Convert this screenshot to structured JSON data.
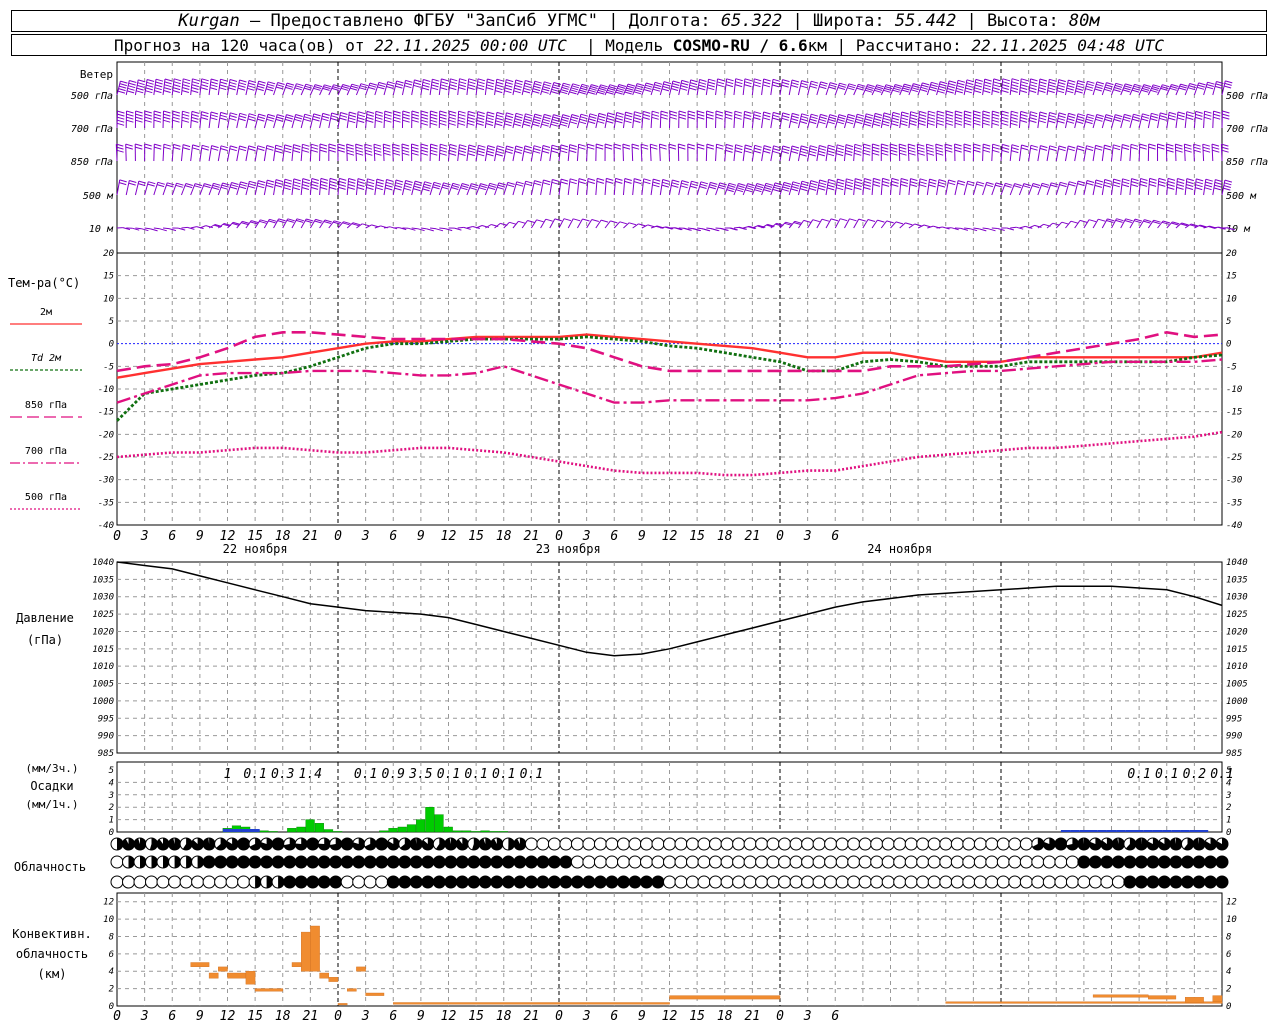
{
  "header": {
    "station": "Kurgan",
    "dash": " – ",
    "provider": "Предоставлено ФГБУ \"ЗапСиб УГМС\"",
    "sep": " | ",
    "lon_label": "Долгота: ",
    "lon": "65.322",
    "lat_label": "Широта: ",
    "lat": "55.442",
    "alt_label": "Высота: ",
    "alt": "80м",
    "forecast_label": "Прогноз на 120 часа(ов) от ",
    "forecast_time": "22.11.2025 00:00 UTC",
    "model_label": "  | Модель ",
    "model": "COSMO-RU / 6.6",
    "model_unit": "км",
    "calc_label": " | Рассчитано: ",
    "calc_time": "22.11.2025 04:48 UTC"
  },
  "colors": {
    "wind": "#8000c8",
    "t2m": "#ff3030",
    "td2m": "#107010",
    "t850": "#e01080",
    "t700": "#e01080",
    "t500": "#e01080",
    "zero": "#2020ff",
    "pressure": "#000000",
    "precip_total": "#00cc00",
    "precip_hourly": "#2040d0",
    "conv": "#f08c30",
    "grid": "#999999"
  },
  "chart_data": [
    {
      "type": "wind",
      "label": "Ветер",
      "levels": [
        "500 гПа",
        "700 гПа",
        "850 гПа",
        "500 м",
        "10  м"
      ],
      "x_hours": [
        0,
        120
      ],
      "icon": "wind-barb-icon"
    },
    {
      "type": "line",
      "ylabel": "Тем-ра(°С)",
      "ylim": [
        -40,
        20
      ],
      "yticks": [
        20,
        15,
        10,
        5,
        0,
        -5,
        -10,
        -15,
        -20,
        -25,
        -30,
        -35,
        -40
      ],
      "x_tick_labels": [
        "0",
        "3",
        "6",
        "9",
        "12",
        "15",
        "18",
        "21",
        "0",
        "3",
        "6",
        "9",
        "12",
        "15",
        "18",
        "21",
        "0",
        "3",
        "6",
        "9",
        "12",
        "15",
        "18",
        "21",
        "0",
        "3",
        "6"
      ],
      "day_labels": [
        "22 ноября",
        "23 ноября",
        "24 ноября"
      ],
      "series": [
        {
          "name": "2м",
          "x": [
            0,
            3,
            6,
            9,
            12,
            15,
            18,
            21,
            24,
            27,
            30,
            33,
            36,
            39,
            42,
            45,
            48,
            51,
            54,
            57,
            60,
            63,
            66,
            69,
            72,
            75,
            78,
            81,
            84,
            87,
            90,
            93,
            96,
            99,
            102,
            105,
            108,
            111,
            114,
            117,
            120
          ],
          "values": [
            -7.5,
            -6.5,
            -5.5,
            -4.5,
            -4,
            -3.5,
            -3,
            -2,
            -1,
            0,
            0.5,
            0.5,
            1,
            1.5,
            1.5,
            1.5,
            1.5,
            2,
            1.5,
            1,
            0.5,
            0,
            -0.5,
            -1,
            -2,
            -3,
            -3,
            -2,
            -2,
            -3,
            -4,
            -4,
            -4,
            -3,
            -3,
            -3,
            -3,
            -3,
            -3,
            -3,
            -2
          ]
        },
        {
          "name": "Td 2м",
          "x": [
            0,
            3,
            6,
            9,
            12,
            15,
            18,
            21,
            24,
            27,
            30,
            33,
            36,
            39,
            42,
            45,
            48,
            51,
            54,
            57,
            60,
            63,
            66,
            69,
            72,
            75,
            78,
            81,
            84,
            87,
            90,
            93,
            96,
            99,
            102,
            105,
            108,
            111,
            114,
            117,
            120
          ],
          "values": [
            -17,
            -11,
            -10,
            -9,
            -8,
            -7,
            -6.5,
            -5,
            -3,
            -1,
            0,
            0,
            0.5,
            1,
            1,
            1,
            1,
            1.5,
            1,
            0.5,
            -0.5,
            -1,
            -2,
            -3,
            -4,
            -6,
            -6,
            -4,
            -3.5,
            -4,
            -5,
            -5,
            -5,
            -4,
            -4,
            -4,
            -4,
            -4,
            -4,
            -3,
            -2.5
          ]
        },
        {
          "name": "850 гПа",
          "x": [
            0,
            3,
            6,
            9,
            12,
            15,
            18,
            21,
            24,
            27,
            30,
            33,
            36,
            39,
            42,
            45,
            48,
            51,
            54,
            57,
            60,
            63,
            66,
            69,
            72,
            75,
            78,
            81,
            84,
            87,
            90,
            93,
            96,
            99,
            102,
            105,
            108,
            111,
            114,
            117,
            120
          ],
          "values": [
            -6,
            -5,
            -4.5,
            -3,
            -1,
            1.5,
            2.5,
            2.5,
            2,
            1.5,
            1,
            1,
            1,
            1,
            1,
            0.5,
            0,
            -1,
            -3,
            -5,
            -6,
            -6,
            -6,
            -6,
            -6,
            -6,
            -6,
            -6,
            -5,
            -5,
            -5,
            -4.5,
            -4,
            -3,
            -2,
            -1,
            0,
            1,
            2.5,
            1.5,
            2
          ]
        },
        {
          "name": "700 гПа",
          "x": [
            0,
            3,
            6,
            9,
            12,
            15,
            18,
            21,
            24,
            27,
            30,
            33,
            36,
            39,
            42,
            45,
            48,
            51,
            54,
            57,
            60,
            63,
            66,
            69,
            72,
            75,
            78,
            81,
            84,
            87,
            90,
            93,
            96,
            99,
            102,
            105,
            108,
            111,
            114,
            117,
            120
          ],
          "values": [
            -13,
            -11,
            -9,
            -7,
            -6.5,
            -6.5,
            -6.5,
            -6,
            -6,
            -6,
            -6.5,
            -7,
            -7,
            -6.5,
            -5,
            -7,
            -9,
            -11,
            -13,
            -13,
            -12.5,
            -12.5,
            -12.5,
            -12.5,
            -12.5,
            -12.5,
            -12,
            -11,
            -9,
            -7,
            -6.5,
            -6,
            -6,
            -5.5,
            -5,
            -4.5,
            -4,
            -4,
            -4,
            -4,
            -3.5
          ]
        },
        {
          "name": "500 гПа",
          "x": [
            0,
            3,
            6,
            9,
            12,
            15,
            18,
            21,
            24,
            27,
            30,
            33,
            36,
            39,
            42,
            45,
            48,
            51,
            54,
            57,
            60,
            63,
            66,
            69,
            72,
            75,
            78,
            81,
            84,
            87,
            90,
            93,
            96,
            99,
            102,
            105,
            108,
            111,
            114,
            117,
            120
          ],
          "values": [
            -25,
            -24.5,
            -24,
            -24,
            -23.5,
            -23,
            -23,
            -23.5,
            -24,
            -24,
            -23.5,
            -23,
            -23,
            -23.5,
            -24,
            -25,
            -26,
            -27,
            -28,
            -28.5,
            -28.5,
            -28.5,
            -29,
            -29,
            -28.5,
            -28,
            -28,
            -27,
            -26,
            -25,
            -24.5,
            -24,
            -23.5,
            -23,
            -23,
            -22.5,
            -22,
            -21.5,
            -21,
            -20.5,
            -19.5
          ]
        }
      ]
    },
    {
      "type": "line",
      "ylabel": "Давление",
      "ylabel2": "(гПа)",
      "ylim": [
        985,
        1040
      ],
      "yticks": [
        1040,
        1035,
        1030,
        1025,
        1020,
        1015,
        1010,
        1005,
        1000,
        995,
        990,
        985
      ],
      "series": [
        {
          "name": "Давление",
          "x": [
            0,
            3,
            6,
            9,
            12,
            15,
            18,
            21,
            24,
            27,
            30,
            33,
            36,
            39,
            42,
            45,
            48,
            51,
            54,
            57,
            60,
            63,
            66,
            69,
            72,
            75,
            78,
            81,
            84,
            87,
            90,
            93,
            96,
            99,
            102,
            105,
            108,
            111,
            114,
            117,
            120
          ],
          "values": [
            1040,
            1039,
            1038,
            1036,
            1034,
            1032,
            1030,
            1028,
            1027,
            1026,
            1025.5,
            1025,
            1024,
            1022,
            1020,
            1018,
            1016,
            1014,
            1013,
            1013.5,
            1015,
            1017,
            1019,
            1021,
            1023,
            1025,
            1027,
            1028.5,
            1029.5,
            1030.5,
            1031,
            1031.5,
            1032,
            1032.5,
            1033,
            1033,
            1033,
            1032.5,
            1032,
            1030,
            1027.5
          ]
        }
      ]
    },
    {
      "type": "bar",
      "ylabel": "(мм/3ч.)",
      "ylabel2": "Осадки",
      "ylabel3": "(мм/1ч.)",
      "ylim": [
        0,
        5
      ],
      "yticks": [
        5,
        4,
        3,
        2,
        1,
        0
      ],
      "totals_3h": [
        {
          "hour": 13.5,
          "label": "1"
        },
        {
          "hour": 16.5,
          "label": "0.1"
        },
        {
          "hour": 19.5,
          "label": "0.3"
        },
        {
          "hour": 22.5,
          "label": "1.4"
        },
        {
          "hour": 28.5,
          "label": "0.1"
        },
        {
          "hour": 31.5,
          "label": "0.9"
        },
        {
          "hour": 34.5,
          "label": "3.5"
        },
        {
          "hour": 37.5,
          "label": "0.1"
        },
        {
          "hour": 40.5,
          "label": "0.1"
        },
        {
          "hour": 43.5,
          "label": "0.1"
        },
        {
          "hour": 46.5,
          "label": "0.1"
        },
        {
          "hour": 112.5,
          "label": "0.1"
        },
        {
          "hour": 115.5,
          "label": "0.1"
        },
        {
          "hour": 118.5,
          "label": "0.2"
        },
        {
          "hour": 121.5,
          "label": "0.1"
        }
      ],
      "hourly": {
        "x": [
          12,
          13,
          14,
          15,
          16,
          17,
          19,
          20,
          21,
          22,
          23,
          24,
          29,
          30,
          31,
          32,
          33,
          34,
          35,
          36,
          37,
          38,
          39,
          40,
          41,
          42
        ],
        "values": [
          0.3,
          0.5,
          0.4,
          0.1,
          0.1,
          0.05,
          0.3,
          0.4,
          1.0,
          0.7,
          0.2,
          0.05,
          0.1,
          0.3,
          0.4,
          0.6,
          1.0,
          2.0,
          1.4,
          0.4,
          0.1,
          0.1,
          0.05,
          0.1,
          0.05,
          0.05
        ]
      }
    },
    {
      "type": "table",
      "label": "Облачность",
      "icon": "cloud-cover-icon",
      "rows": 3
    },
    {
      "type": "bar",
      "ylabel": "Конвективн.",
      "ylabel2": "облачность",
      "ylabel3": "(км)",
      "ylim": [
        0,
        13
      ],
      "yticks": [
        12,
        10,
        8,
        6,
        4,
        2,
        0
      ],
      "segments": [
        {
          "x0": 8,
          "x1": 10,
          "base": 4.5,
          "top": 5
        },
        {
          "x0": 10,
          "x1": 11,
          "base": 3.2,
          "top": 3.8
        },
        {
          "x0": 11,
          "x1": 12,
          "base": 4,
          "top": 4.5
        },
        {
          "x0": 12,
          "x1": 14,
          "base": 3.2,
          "top": 3.8
        },
        {
          "x0": 14,
          "x1": 15,
          "base": 2.5,
          "top": 4
        },
        {
          "x0": 15,
          "x1": 18,
          "base": 1.7,
          "top": 2
        },
        {
          "x0": 19,
          "x1": 20,
          "base": 4.5,
          "top": 5
        },
        {
          "x0": 20,
          "x1": 21,
          "base": 4,
          "top": 8.5
        },
        {
          "x0": 21,
          "x1": 22,
          "base": 4,
          "top": 9.2
        },
        {
          "x0": 22,
          "x1": 23,
          "base": 3.2,
          "top": 3.8
        },
        {
          "x0": 23,
          "x1": 24,
          "base": 2.8,
          "top": 3.3
        },
        {
          "x0": 24,
          "x1": 25,
          "base": 0.2,
          "top": 0.3
        },
        {
          "x0": 25,
          "x1": 26,
          "base": 1.7,
          "top": 2.0
        },
        {
          "x0": 26,
          "x1": 27,
          "base": 4,
          "top": 4.5
        },
        {
          "x0": 27,
          "x1": 29,
          "base": 1.2,
          "top": 1.5
        },
        {
          "x0": 30,
          "x1": 60,
          "base": 0.2,
          "top": 0.4
        },
        {
          "x0": 60,
          "x1": 72,
          "base": 0.8,
          "top": 1.2
        },
        {
          "x0": 90,
          "x1": 120,
          "base": 0.3,
          "top": 0.5
        },
        {
          "x0": 106,
          "x1": 112,
          "base": 1.0,
          "top": 1.3
        },
        {
          "x0": 112,
          "x1": 115,
          "base": 0.8,
          "top": 1.2
        },
        {
          "x0": 116,
          "x1": 118,
          "base": 0.4,
          "top": 1.0
        },
        {
          "x0": 119,
          "x1": 120,
          "base": 0.5,
          "top": 1.2
        }
      ]
    }
  ]
}
